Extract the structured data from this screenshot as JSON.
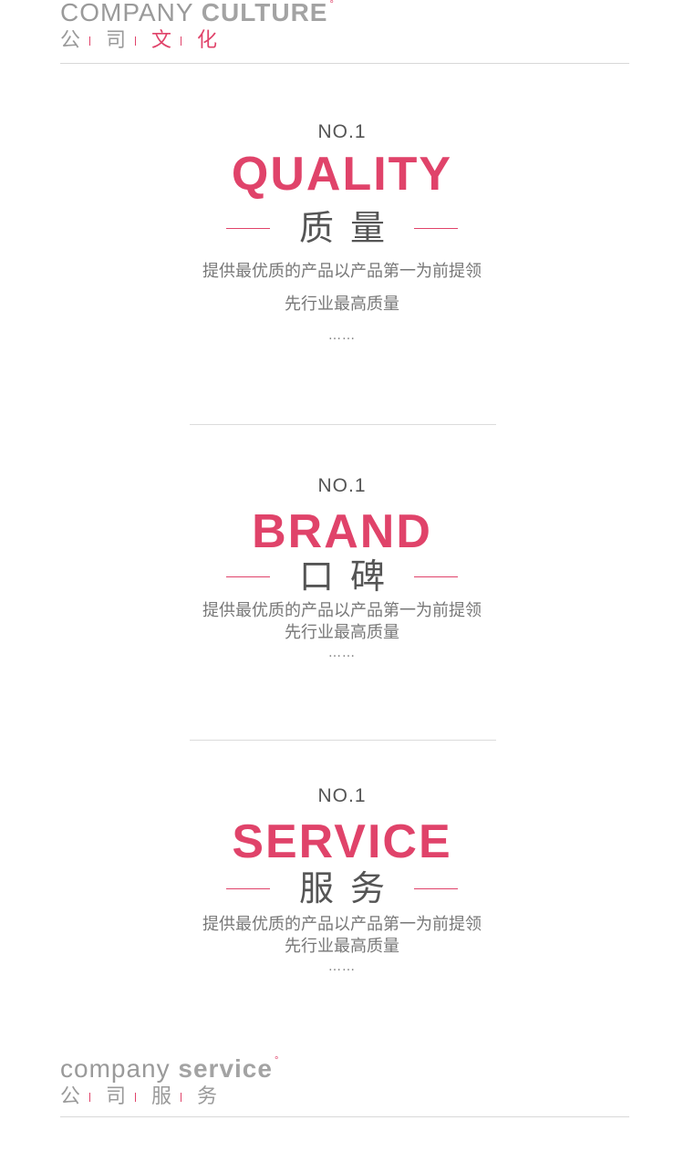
{
  "header_top": {
    "en_light": "COMPANY ",
    "en_bold": "CULTURE",
    "degree": "°",
    "cn": [
      "公",
      "司",
      "文",
      "化"
    ]
  },
  "sections": [
    {
      "no": "NO.1",
      "title": "QUALITY",
      "cn_title": "质量",
      "desc_line1": "提供最优质的产品以产品第一为前提领",
      "desc_line2": "先行业最高质量",
      "dots": "……"
    },
    {
      "no": "NO.1",
      "title": "BRAND",
      "cn_title": "口碑",
      "desc_line1": "提供最优质的产品以产品第一为前提领",
      "desc_line2": "先行业最高质量",
      "dots": "……"
    },
    {
      "no": "NO.1",
      "title": "SERVICE",
      "cn_title": "服务",
      "desc_line1": "提供最优质的产品以产品第一为前提领",
      "desc_line2": "先行业最高质量",
      "dots": "……"
    }
  ],
  "header_bottom": {
    "en_light": "company ",
    "en_bold": "service",
    "degree": "°",
    "cn": [
      "公",
      "司",
      "服",
      "务"
    ]
  },
  "colors": {
    "accent": "#e0436a",
    "text": "#555555",
    "muted": "#9a9a9a"
  }
}
